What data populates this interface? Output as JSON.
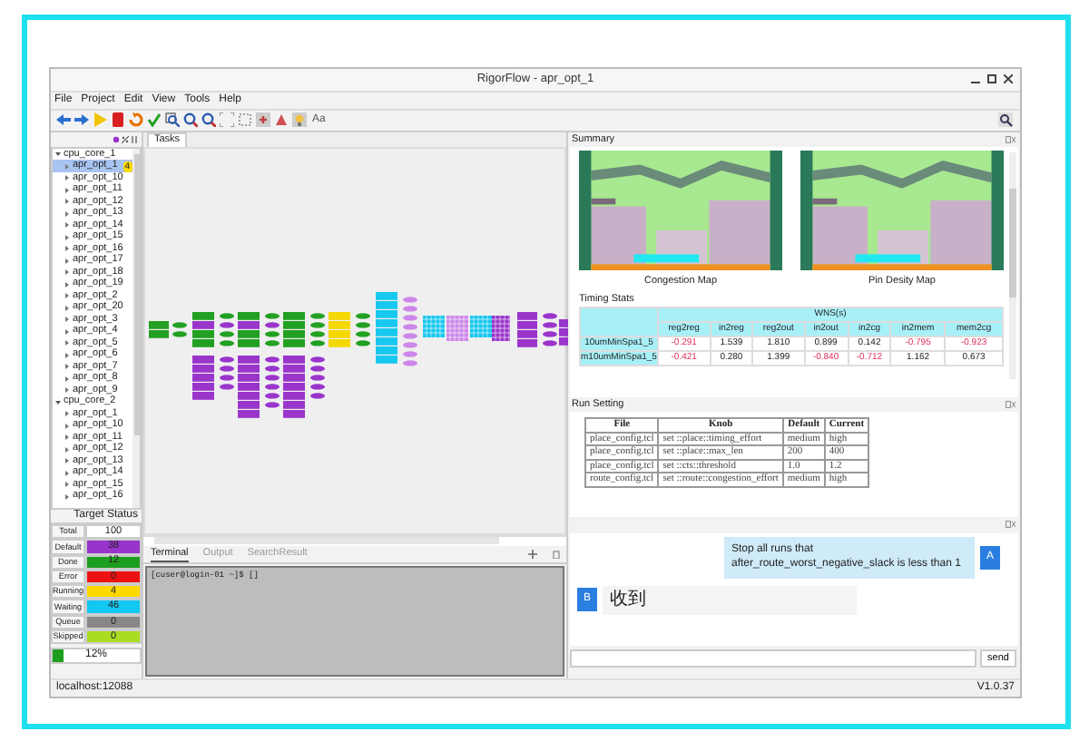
{
  "window": {
    "title": "RigorFlow - apr_opt_1"
  },
  "menu": [
    "File",
    "Project",
    "Edit",
    "View",
    "Tools",
    "Help"
  ],
  "toolbar": {
    "font_label": "Aa"
  },
  "tree": [
    {
      "label": "cpu_core_1",
      "expanded": true,
      "children": [
        {
          "label": "apr_opt_1",
          "selected": true,
          "expanded": false,
          "badge": "4"
        },
        {
          "label": "apr_opt_10",
          "selected": false,
          "expanded": false
        },
        {
          "label": "apr_opt_11",
          "selected": false,
          "expanded": false
        },
        {
          "label": "apr_opt_12",
          "selected": false,
          "expanded": false
        },
        {
          "label": "apr_opt_13",
          "selected": false,
          "expanded": false
        },
        {
          "label": "apr_opt_14",
          "selected": false,
          "expanded": false
        },
        {
          "label": "apr_opt_15",
          "selected": false,
          "expanded": false
        },
        {
          "label": "apr_opt_16",
          "selected": false,
          "expanded": false
        },
        {
          "label": "apr_opt_17",
          "selected": false,
          "expanded": false
        },
        {
          "label": "apr_opt_18",
          "selected": false,
          "expanded": false
        },
        {
          "label": "apr_opt_19",
          "selected": false,
          "expanded": false
        },
        {
          "label": "apr_opt_2",
          "selected": false,
          "expanded": false
        },
        {
          "label": "apr_opt_20",
          "selected": false,
          "expanded": false
        },
        {
          "label": "apr_opt_3",
          "selected": false,
          "expanded": false
        },
        {
          "label": "apr_opt_4",
          "selected": false,
          "expanded": false
        },
        {
          "label": "apr_opt_5",
          "selected": false,
          "expanded": false
        },
        {
          "label": "apr_opt_6",
          "selected": false,
          "expanded": false
        },
        {
          "label": "apr_opt_7",
          "selected": false,
          "expanded": false
        },
        {
          "label": "apr_opt_8",
          "selected": false,
          "expanded": false
        },
        {
          "label": "apr_opt_9",
          "selected": false,
          "expanded": false
        }
      ]
    },
    {
      "label": "cpu_core_2",
      "expanded": true,
      "children": [
        {
          "label": "apr_opt_1",
          "selected": false,
          "expanded": false
        },
        {
          "label": "apr_opt_10",
          "selected": false,
          "expanded": false
        },
        {
          "label": "apr_opt_11",
          "selected": false,
          "expanded": false
        },
        {
          "label": "apr_opt_12",
          "selected": false,
          "expanded": false
        },
        {
          "label": "apr_opt_13",
          "selected": false,
          "expanded": false
        },
        {
          "label": "apr_opt_14",
          "selected": false,
          "expanded": false
        },
        {
          "label": "apr_opt_15",
          "selected": false,
          "expanded": false
        },
        {
          "label": "apr_opt_16",
          "selected": false,
          "expanded": false
        }
      ]
    }
  ],
  "target_status": {
    "title": "Target Status",
    "rows": [
      {
        "label": "Total",
        "value": "100"
      },
      {
        "label": "Default",
        "value": "38",
        "color": "#9933cc"
      },
      {
        "label": "Done",
        "value": "12",
        "color": "#1e9e1e"
      },
      {
        "label": "Error",
        "value": "0",
        "color": "#ee1111"
      },
      {
        "label": "Running",
        "value": "4",
        "color": "#ffd800"
      },
      {
        "label": "Waiting",
        "value": "46",
        "color": "#11c8f0"
      },
      {
        "label": "Queue",
        "value": "0",
        "color": "#888888"
      },
      {
        "label": "Skipped",
        "value": "0",
        "color": "#aadd22"
      }
    ],
    "progress": {
      "level": 0.12,
      "reading": "12%"
    }
  },
  "tasks_tab": {
    "label": "Tasks",
    "selected": true
  },
  "console": {
    "tabs": [
      {
        "label": "Terminal",
        "selected": true
      },
      {
        "label": "Output",
        "selected": false
      },
      {
        "label": "SearchResult",
        "selected": false
      }
    ],
    "prompt": "[cuser@login-01 ~]$ []"
  },
  "summary": {
    "title": "Summary",
    "maps": [
      {
        "caption": "Congestion Map"
      },
      {
        "caption": "Pin Desity Map"
      }
    ],
    "timing": {
      "title": "Timing Stats",
      "group": "WNS(s)",
      "columns": [
        "reg2reg",
        "in2reg",
        "reg2out",
        "in2out",
        "in2cg",
        "in2mem",
        "mem2cg"
      ],
      "rows": [
        {
          "name": "10umMinSpa1_5",
          "cells": [
            {
              "value": "-0.291",
              "negative": true
            },
            {
              "value": "1.539",
              "negative": false
            },
            {
              "value": "1.810",
              "negative": false
            },
            {
              "value": "0.899",
              "negative": false
            },
            {
              "value": "0.142",
              "negative": false
            },
            {
              "value": "-0.795",
              "negative": true
            },
            {
              "value": "-0.923",
              "negative": true
            }
          ]
        },
        {
          "name": "m10umMinSpa1_5",
          "cells": [
            {
              "value": "-0.421",
              "negative": true
            },
            {
              "value": "0.280",
              "negative": false
            },
            {
              "value": "1.399",
              "negative": false
            },
            {
              "value": "-0.840",
              "negative": true
            },
            {
              "value": "-0.712",
              "negative": true
            },
            {
              "value": "1.162",
              "negative": false
            },
            {
              "value": "0.673",
              "negative": false
            }
          ]
        }
      ]
    }
  },
  "run_setting": {
    "title": "Run Setting",
    "columns": [
      "File",
      "Knob",
      "Default",
      "Current"
    ],
    "rows": [
      [
        "place_config.tcl",
        "set ::place::timing_effort",
        "medium",
        "high"
      ],
      [
        "place_config.tcl",
        "set ::place::max_len",
        "200",
        "400"
      ],
      [
        "place_config.tcl",
        "set ::cts::threshold",
        "1.0",
        "1.2"
      ],
      [
        "route_config.tcl",
        "set ::route::congestion_effort",
        "medium",
        "high"
      ]
    ]
  },
  "chat": {
    "messages": [
      {
        "kind": "sent",
        "avatar": "A",
        "text": "Stop all runs that after_route_worst_negative_slack is less than 1"
      },
      {
        "kind": "received",
        "avatar": "B",
        "text": "收到"
      }
    ],
    "send": "send"
  },
  "status_bar": {
    "host": "localhost:12088",
    "version": "V1.0.37"
  }
}
